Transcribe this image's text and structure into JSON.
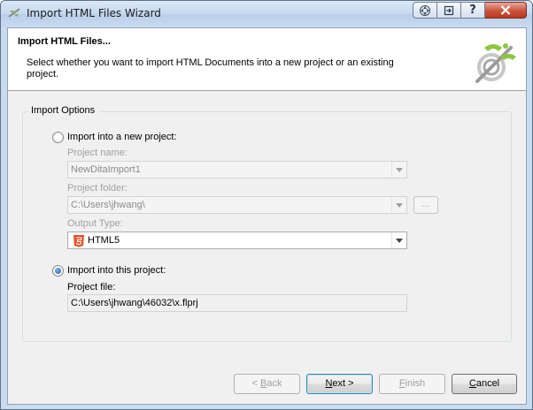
{
  "window": {
    "title": "Import HTML Files Wizard",
    "icon": "mad-cap-flare-app-icon",
    "controls": [
      "nav-icon",
      "pin-icon",
      "help-icon",
      "close-icon"
    ]
  },
  "header": {
    "title": "Import HTML Files...",
    "description": "Select whether you want to import HTML Documents into a new project or an existing project.",
    "logo": "wizard-wand-logo"
  },
  "options": {
    "group_title": "Import Options",
    "new_project": {
      "radio_label": "Import into a new project:",
      "selected": false,
      "project_name_label": "Project name:",
      "project_name_value": "NewDitaImport1",
      "project_folder_label": "Project folder:",
      "project_folder_value": "C:\\Users\\jhwang\\",
      "browse_label": "...",
      "output_type_label": "Output Type:",
      "output_type_value": "HTML5",
      "output_type_icon": "html5-icon"
    },
    "this_project": {
      "radio_label": "Import into this project:",
      "selected": true,
      "project_file_label": "Project file:",
      "project_file_value": "C:\\Users\\jhwang\\46032\\x.flprj"
    }
  },
  "buttons": {
    "back": {
      "prefix": "< ",
      "mnemonic": "B",
      "rest": "ack",
      "enabled": false
    },
    "next": {
      "mnemonic": "N",
      "rest": "ext >",
      "enabled": true
    },
    "finish": {
      "mnemonic": "F",
      "rest": "inish",
      "enabled": false
    },
    "cancel": {
      "mnemonic": "C",
      "rest": "ancel",
      "enabled": true
    }
  },
  "colors": {
    "window_frame": "#c9dcef",
    "close_button": "#c9533c",
    "radio_selected": "#1e5fa8",
    "disabled_text": "#a0a0a0"
  }
}
